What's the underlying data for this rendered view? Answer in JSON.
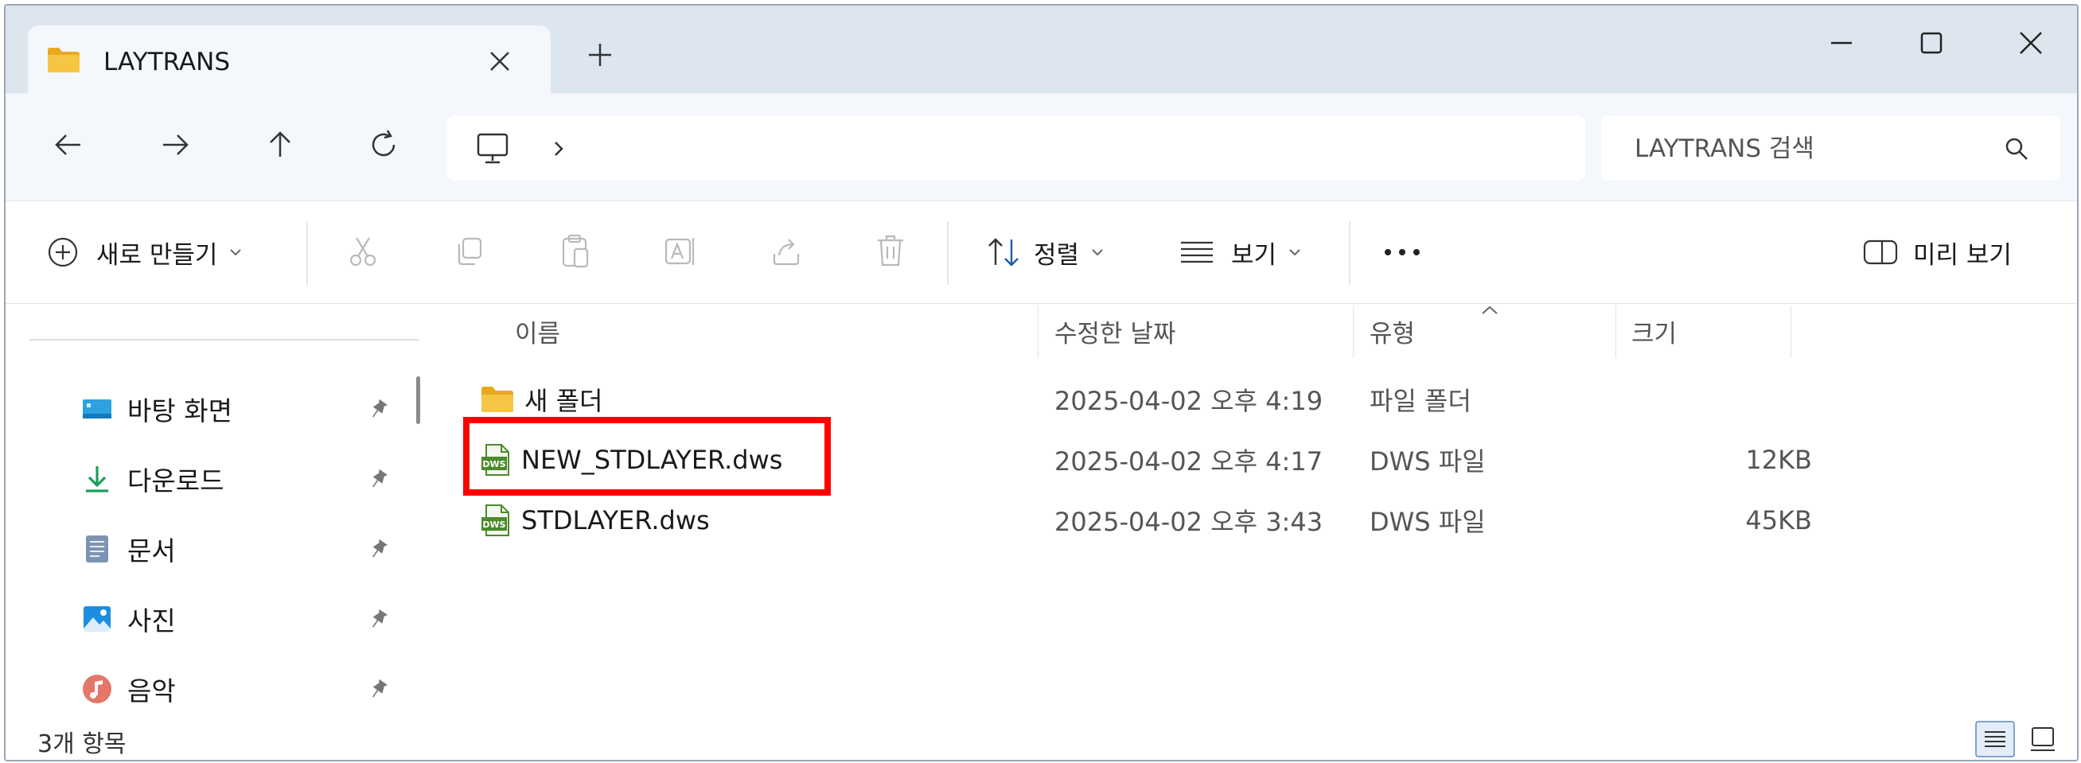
{
  "window": {
    "tab_title": "LAYTRANS",
    "tab_icon": "folder-icon",
    "controls": [
      "minimize-icon",
      "maximize-icon",
      "close-icon"
    ]
  },
  "nav": {
    "buttons": [
      "back-icon",
      "forward-icon",
      "up-icon",
      "refresh-icon"
    ],
    "address_icon": "this-pc-icon",
    "search_placeholder": "LAYTRANS 검색"
  },
  "toolbar": {
    "new_label": "새로 만들기",
    "sort_label": "정렬",
    "view_label": "보기",
    "more_label": "···",
    "preview_label": "미리 보기",
    "disabled_actions": [
      "cut-icon",
      "copy-icon",
      "paste-icon",
      "rename-icon",
      "share-icon",
      "delete-icon"
    ]
  },
  "sidebar": {
    "items": [
      {
        "label": "바탕 화면",
        "icon": "desktop-icon"
      },
      {
        "label": "다운로드",
        "icon": "download-icon"
      },
      {
        "label": "문서",
        "icon": "documents-icon"
      },
      {
        "label": "사진",
        "icon": "pictures-icon"
      },
      {
        "label": "음악",
        "icon": "music-icon"
      }
    ]
  },
  "columns": {
    "name": "이름",
    "date": "수정한 날짜",
    "type": "유형",
    "size": "크기"
  },
  "files": [
    {
      "name": "새 폴더",
      "date": "2025-04-02 오후 4:19",
      "type": "파일 폴더",
      "size": "",
      "icon": "folder-icon"
    },
    {
      "name": "NEW_STDLAYER.dws",
      "date": "2025-04-02 오후 4:17",
      "type": "DWS 파일",
      "size": "12KB",
      "icon": "dws-file-icon",
      "highlighted": true
    },
    {
      "name": "STDLAYER.dws",
      "date": "2025-04-02 오후 3:43",
      "type": "DWS 파일",
      "size": "45KB",
      "icon": "dws-file-icon"
    }
  ],
  "status": {
    "item_count": "3개 항목"
  },
  "colors": {
    "highlight": "#ff0000",
    "titlebar": "#dde5ef",
    "navbar": "#f4f7fb",
    "folder": "#f6c544",
    "dws_icon": "#4a8a2a"
  }
}
